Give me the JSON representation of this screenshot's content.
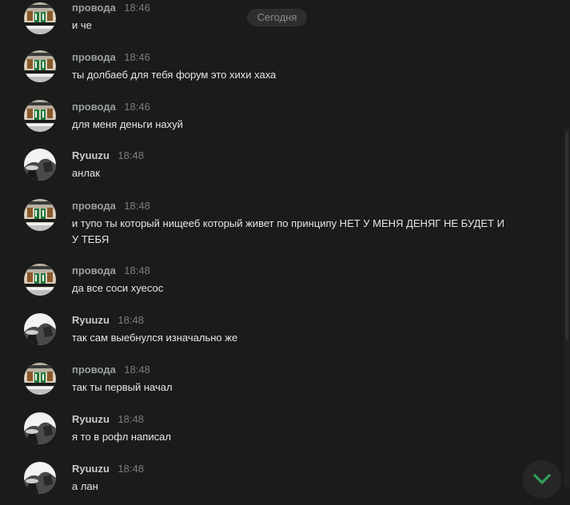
{
  "date_separator": "Сегодня",
  "users": {
    "provoda": {
      "name": "провода",
      "avatar_icon": "green-jersey-team-photo-icon"
    },
    "ryuuzu": {
      "name": "Ryuuzu",
      "avatar_icon": "grayscale-figure-icon"
    }
  },
  "messages": [
    {
      "author": "провода",
      "time": "18:46",
      "text": "и че"
    },
    {
      "author": "провода",
      "time": "18:46",
      "text": "ты долбаеб для тебя форум это хихи хаха"
    },
    {
      "author": "провода",
      "time": "18:46",
      "text": "для меня деньги нахуй"
    },
    {
      "author": "Ryuuzu",
      "time": "18:48",
      "text": "анлак"
    },
    {
      "author": "провода",
      "time": "18:48",
      "text": "и тупо ты который нищееб который живет по принципу НЕТ У МЕНЯ ДЕНЯГ НЕ БУДЕТ И У ТЕБЯ"
    },
    {
      "author": "провода",
      "time": "18:48",
      "text": "да все соси хуесос"
    },
    {
      "author": "Ryuuzu",
      "time": "18:48",
      "text": "так сам выебнулся изначально же"
    },
    {
      "author": "провода",
      "time": "18:48",
      "text": "так ты первый начал"
    },
    {
      "author": "Ryuuzu",
      "time": "18:48",
      "text": "я то в рофл написал"
    },
    {
      "author": "Ryuuzu",
      "time": "18:48",
      "text": "а лан"
    }
  ],
  "jump_button_icon": "chevron-down-icon",
  "colors": {
    "background": "#1b1b1b",
    "accent": "#2fa35a",
    "text": "#e6e6e6",
    "muted": "#7d7d7d"
  }
}
